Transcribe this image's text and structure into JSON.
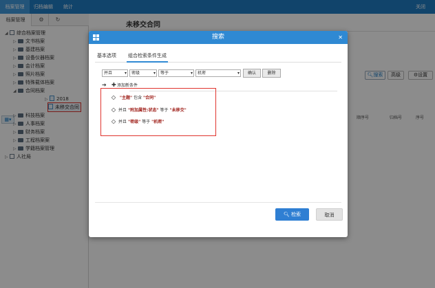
{
  "topbar": {
    "menu": [
      "档案管理",
      "归档编辑",
      "统计"
    ],
    "close": "关闭"
  },
  "left": {
    "tab": "档案管理",
    "tree": [
      "综合档案管理",
      "文书档案",
      "基建档案",
      "设备仪器档案",
      "会计档案",
      "照片档案",
      "特殊载体档案",
      "合同档案",
      "2018",
      "未移交合同",
      "科技档案",
      "人事档案",
      "财务档案",
      "工程档案案",
      "学籍档案管理",
      "人社局"
    ]
  },
  "main": {
    "title": "未移交合同",
    "search_label": "搜索",
    "advanced_label": "高级",
    "settings_label": "设置",
    "columns": [
      "顺序号",
      "归档号",
      "序号"
    ]
  },
  "dialog": {
    "title": "搜索",
    "tabs": [
      "基本选项",
      "组合检索条件生成"
    ],
    "row": {
      "logic": "并且",
      "field": "密级",
      "op": "等于",
      "value": "机密",
      "confirm": "确认",
      "delete": "删除"
    },
    "add_condition": "添加新条件",
    "conditions": [
      {
        "prefix": "",
        "field": "\"主题\"",
        "op": "包含",
        "value": "\"合同\""
      },
      {
        "prefix": "并且",
        "field": "\"附加属性:状态\"",
        "op": "等于",
        "value": "\"未移交\""
      },
      {
        "prefix": "并且",
        "field": "\"密级\"",
        "op": "等于",
        "value": "\"机密\""
      }
    ],
    "search_button": "检索",
    "cancel_button": "取消"
  },
  "colors": {
    "primary": "#2f89d3",
    "topbar": "#1f7cc4",
    "highlight": "#e0332c"
  }
}
